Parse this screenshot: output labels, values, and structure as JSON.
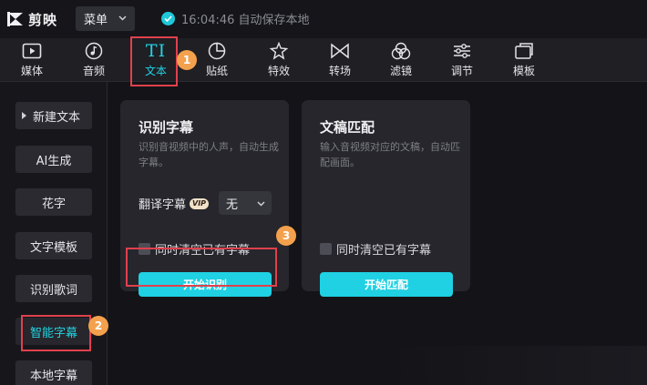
{
  "app": {
    "logo_text": "剪映",
    "menu_label": "菜单",
    "save_status": "16:04:46 自动保存本地"
  },
  "toolbar": {
    "items": [
      {
        "label": "媒体",
        "icon": "media-play-icon"
      },
      {
        "label": "音频",
        "icon": "music-note-icon"
      },
      {
        "label": "文本",
        "icon": "text-icon",
        "icon_text": "TI",
        "active": true
      },
      {
        "label": "贴纸",
        "icon": "sticker-icon"
      },
      {
        "label": "特效",
        "icon": "effects-star-icon"
      },
      {
        "label": "转场",
        "icon": "transition-icon"
      },
      {
        "label": "滤镜",
        "icon": "filter-icon"
      },
      {
        "label": "调节",
        "icon": "adjust-sliders-icon"
      },
      {
        "label": "模板",
        "icon": "template-icon"
      }
    ]
  },
  "sidebar": {
    "items": [
      {
        "label": "新建文本"
      },
      {
        "label": "AI生成"
      },
      {
        "label": "花字"
      },
      {
        "label": "文字模板"
      },
      {
        "label": "识别歌词"
      },
      {
        "label": "智能字幕",
        "active": true
      },
      {
        "label": "本地字幕"
      }
    ]
  },
  "cards": {
    "recognize": {
      "title": "识别字幕",
      "description": "识别音视频中的人声，自动生成字幕。",
      "translate_label": "翻译字幕",
      "vip_badge": "VIP",
      "translate_value": "无",
      "checkbox_label": "同时清空已有字幕",
      "button_label": "开始识别"
    },
    "match": {
      "title": "文稿匹配",
      "description": "输入音视频对应的文稿，自动匹配画面。",
      "checkbox_label": "同时清空已有字幕",
      "button_label": "开始匹配"
    }
  },
  "annotations": {
    "step1": "1",
    "step2": "2",
    "step3": "3"
  },
  "colors": {
    "accent": "#22d3e4",
    "button": "#1fd1e3",
    "highlight_border": "#e0404d",
    "step_badge": "#f4a14d"
  }
}
